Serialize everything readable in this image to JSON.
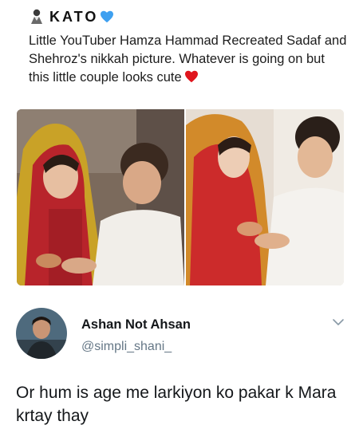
{
  "header": {
    "brand": "KATO",
    "person_icon": "person-icon",
    "heart_icon": "blue-heart-icon",
    "heart_color": "#3ea0f0"
  },
  "post": {
    "caption": "Little YouTuber Hamza Hammad Recreated Sadaf and Shehroz's nikkah picture. Whatever is going on but this little couple looks cute",
    "heart_icon": "red-heart-icon",
    "heart_color": "#e0161e"
  },
  "tweet": {
    "display_name": "Ashan Not Ahsan",
    "handle": "@simpli_shani_",
    "text": "Or hum is age me larkiyon ko pakar k Mara krtay thay",
    "menu_icon": "chevron-down-icon"
  }
}
